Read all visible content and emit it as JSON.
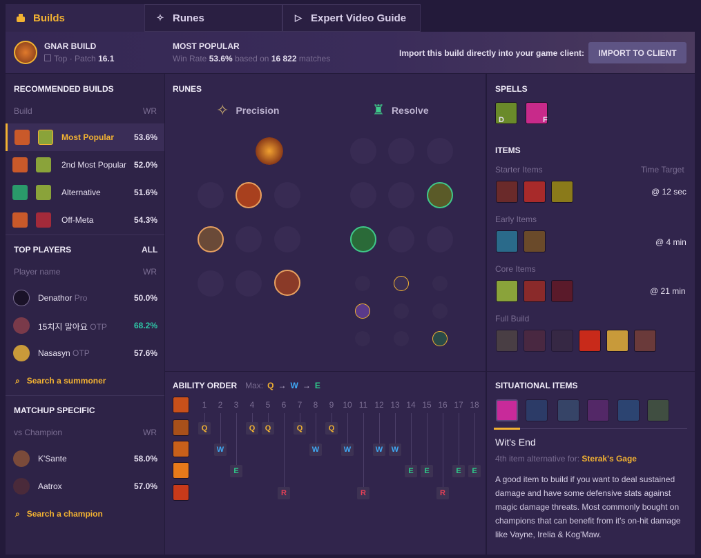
{
  "tabs": [
    {
      "label": "Builds"
    },
    {
      "label": "Runes"
    },
    {
      "label": "Expert Video Guide"
    }
  ],
  "header": {
    "champion_title": "GNAR BUILD",
    "role": "Top",
    "patch_label": "Patch",
    "patch": "16.1",
    "most_popular": "MOST POPULAR",
    "win_rate_label": "Win Rate",
    "win_rate": "53.6%",
    "based_on": "based on",
    "matches": "16 822",
    "matches_suffix": "matches",
    "import_text": "Import this build directly into your game client:",
    "import_button": "IMPORT TO CLIENT"
  },
  "recommended": {
    "title": "RECOMMENDED BUILDS",
    "col_build": "Build",
    "col_wr": "WR",
    "items": [
      {
        "label": "Most Popular",
        "wr": "53.6%"
      },
      {
        "label": "2nd Most Popular",
        "wr": "52.0%"
      },
      {
        "label": "Alternative",
        "wr": "51.6%"
      },
      {
        "label": "Off-Meta",
        "wr": "54.3%"
      }
    ]
  },
  "top_players": {
    "title": "TOP PLAYERS",
    "all": "ALL",
    "col_name": "Player name",
    "col_wr": "WR",
    "players": [
      {
        "name": "Denathor",
        "tag": "Pro",
        "wr": "50.0%"
      },
      {
        "name": "15치지 말아요",
        "tag": "OTP",
        "wr": "68.2%"
      },
      {
        "name": "Nasasyn",
        "tag": "OTP",
        "wr": "57.6%"
      }
    ],
    "search": "Search a summoner"
  },
  "matchup": {
    "title": "MATCHUP SPECIFIC",
    "col_vs": "vs Champion",
    "col_wr": "WR",
    "items": [
      {
        "name": "K'Sante",
        "wr": "58.0%"
      },
      {
        "name": "Aatrox",
        "wr": "57.0%"
      }
    ],
    "search": "Search a champion"
  },
  "runes": {
    "title": "RUNES",
    "primary": "Precision",
    "secondary": "Resolve"
  },
  "spells": {
    "title": "SPELLS",
    "keys": [
      "D",
      "F"
    ]
  },
  "items": {
    "title": "ITEMS",
    "starter": "Starter Items",
    "time_target": "Time Target",
    "starter_time": "@ 12 sec",
    "early": "Early Items",
    "early_time": "@ 4 min",
    "core": "Core Items",
    "core_time": "@ 21 min",
    "full": "Full Build"
  },
  "ability": {
    "title": "ABILITY ORDER",
    "max_label": "Max:",
    "max": [
      "Q",
      "W",
      "E"
    ],
    "levels": [
      "1",
      "2",
      "3",
      "4",
      "5",
      "6",
      "7",
      "8",
      "9",
      "10",
      "11",
      "12",
      "13",
      "14",
      "15",
      "16",
      "17",
      "18"
    ],
    "q": "Q",
    "w": "W",
    "e": "E",
    "r": "R"
  },
  "situational": {
    "title": "SITUATIONAL ITEMS",
    "item_name": "Wit's End",
    "alt_prefix": "4th item alternative for:",
    "alt_item": "Sterak's Gage",
    "description": "A good item to build if you want to deal sustained damage and have some defensive stats against magic damage threats. Most commonly bought on champions that can benefit from it's on-hit damage like Vayne, Irelia & Kog'Maw."
  },
  "colors": {
    "gold": "#f2b232",
    "teal": "#2ec9a8",
    "q": "#f2b232",
    "w": "#3fa9f5",
    "e": "#2ec98a",
    "r": "#e84057",
    "button": "#5e5484"
  }
}
